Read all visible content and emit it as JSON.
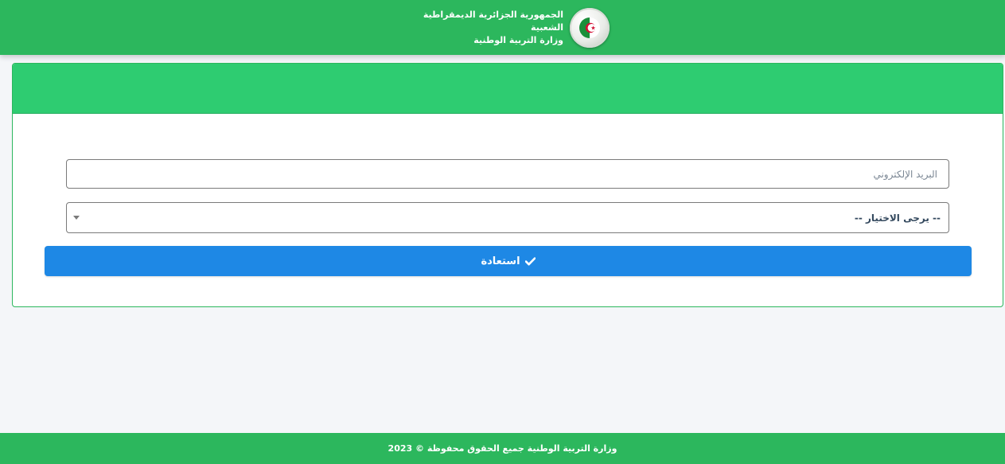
{
  "header": {
    "line1": "الجمهورية الجزائرية الديمقراطية الشعبية",
    "line2": "وزارة التربية الوطنية",
    "emblem_icon": "algeria-flag-emblem-icon"
  },
  "form": {
    "email_placeholder": "البريد الإلكتروني",
    "email_value": "",
    "select_value": "-- يرجى الاختيار --",
    "submit_label": "استعادة",
    "submit_icon": "check-icon"
  },
  "footer": {
    "text": "وزارة التربية الوطنية جميع الحقوق محفوظة © 2023"
  },
  "colors": {
    "header_green": "#2cb75d",
    "card_header_green": "#2ecc71",
    "button_blue": "#1e88e5",
    "page_background": "#f4f6f9"
  }
}
